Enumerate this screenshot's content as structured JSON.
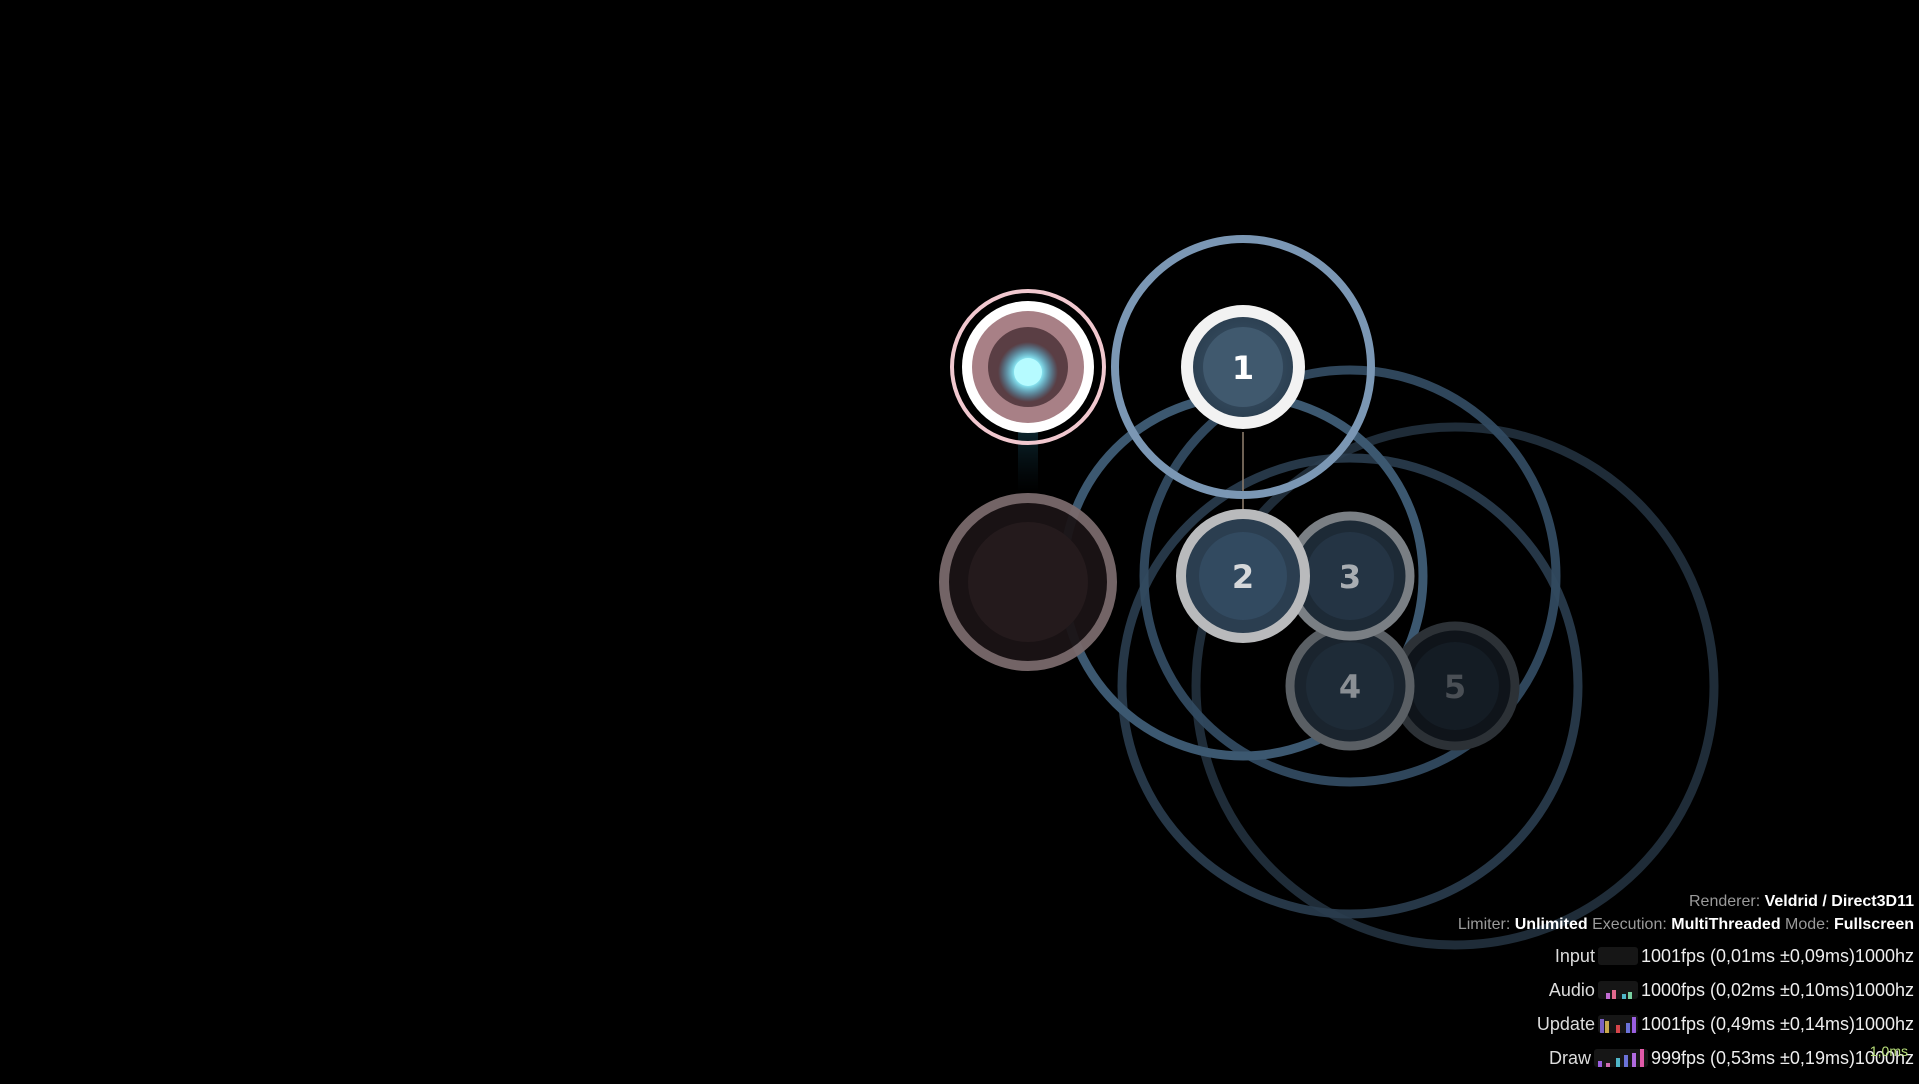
{
  "playfield": {
    "hit_circles": [
      {
        "number": "1"
      },
      {
        "number": "2"
      },
      {
        "number": "3"
      },
      {
        "number": "4"
      },
      {
        "number": "5"
      }
    ]
  },
  "overlay": {
    "renderer_label": "Renderer:",
    "renderer_value": "Veldrid / Direct3D11",
    "limiter_label": "Limiter:",
    "limiter_value": "Unlimited",
    "execution_label": "Execution:",
    "execution_value": "MultiThreaded",
    "mode_label": "Mode:",
    "mode_value": "Fullscreen",
    "stats": [
      {
        "name": "Input",
        "text": "1001fps (0,01ms ±0,09ms)1000hz"
      },
      {
        "name": "Audio",
        "text": "1000fps (0,02ms ±0,10ms)1000hz"
      },
      {
        "name": "Update",
        "text": "1001fps (0,49ms ±0,14ms)1000hz"
      },
      {
        "name": "Draw",
        "text": "999fps (0,53ms ±0,19ms)1000hz"
      }
    ],
    "ms_label": "1,0ms"
  },
  "colors": {
    "background": "#000000",
    "circle_fill": "#3d5870",
    "approach_ring": "#7b97b4",
    "pressed_ring": "#f1c8cf",
    "cursor": "#9ff6ff",
    "limiter_value": "#ffffff"
  }
}
